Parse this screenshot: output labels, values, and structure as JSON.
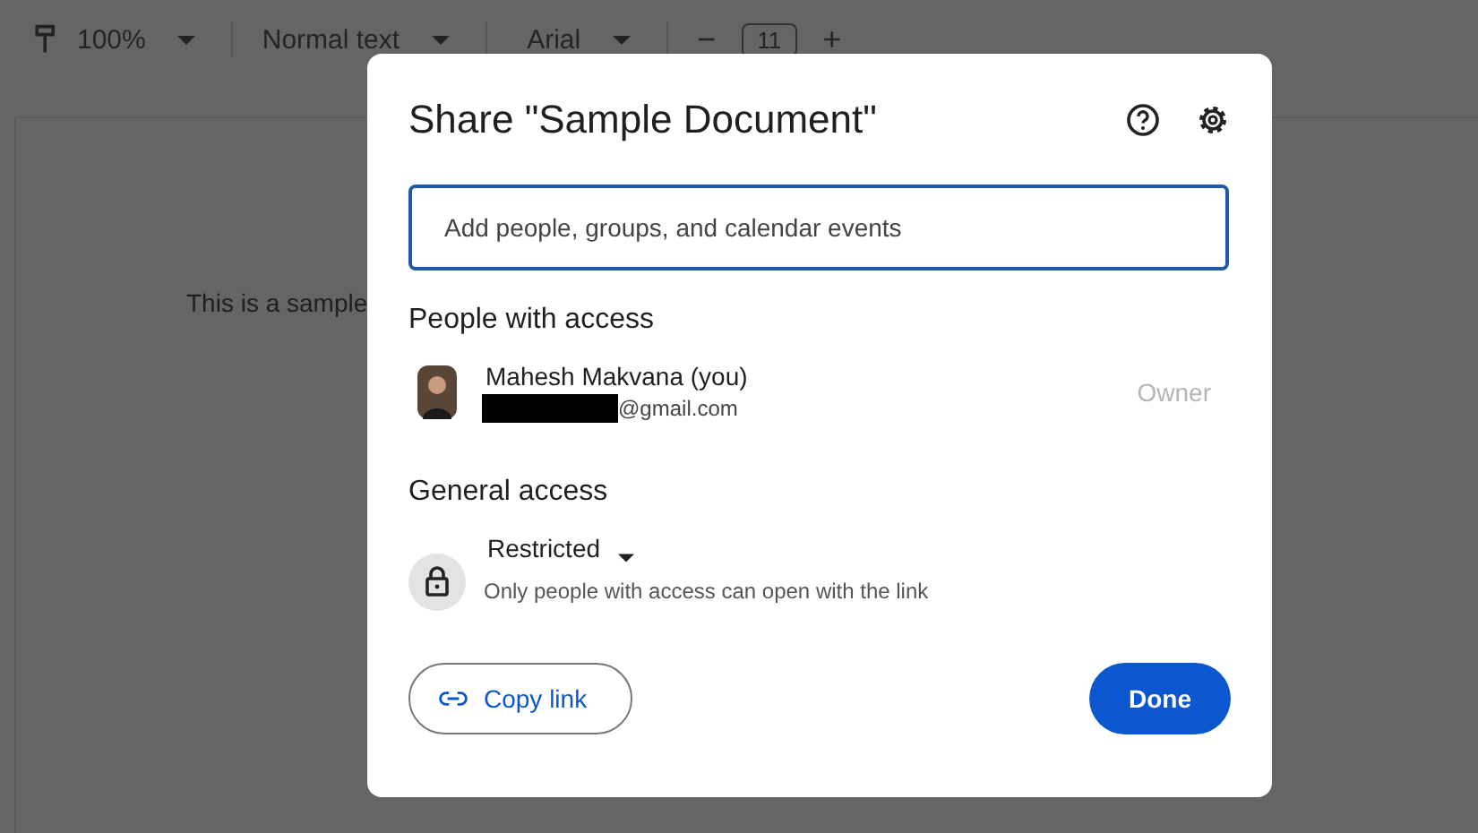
{
  "toolbar": {
    "zoom": "100%",
    "style": "Normal text",
    "font": "Arial",
    "font_size": "11",
    "decrease": "−",
    "increase": "+"
  },
  "document": {
    "text": "This is a sample"
  },
  "dialog": {
    "title": "Share \"Sample Document\"",
    "search": {
      "placeholder": "Add people, groups, and calendar events"
    },
    "people_heading": "People with access",
    "people": [
      {
        "name": "Mahesh Makvana (you)",
        "email": "@gmail.com",
        "email_redacted": true,
        "role": "Owner"
      }
    ],
    "general_heading": "General access",
    "access": {
      "setting": "Restricted",
      "description": "Only people with access can open with the link"
    },
    "copy_link": "Copy link",
    "done": "Done"
  }
}
